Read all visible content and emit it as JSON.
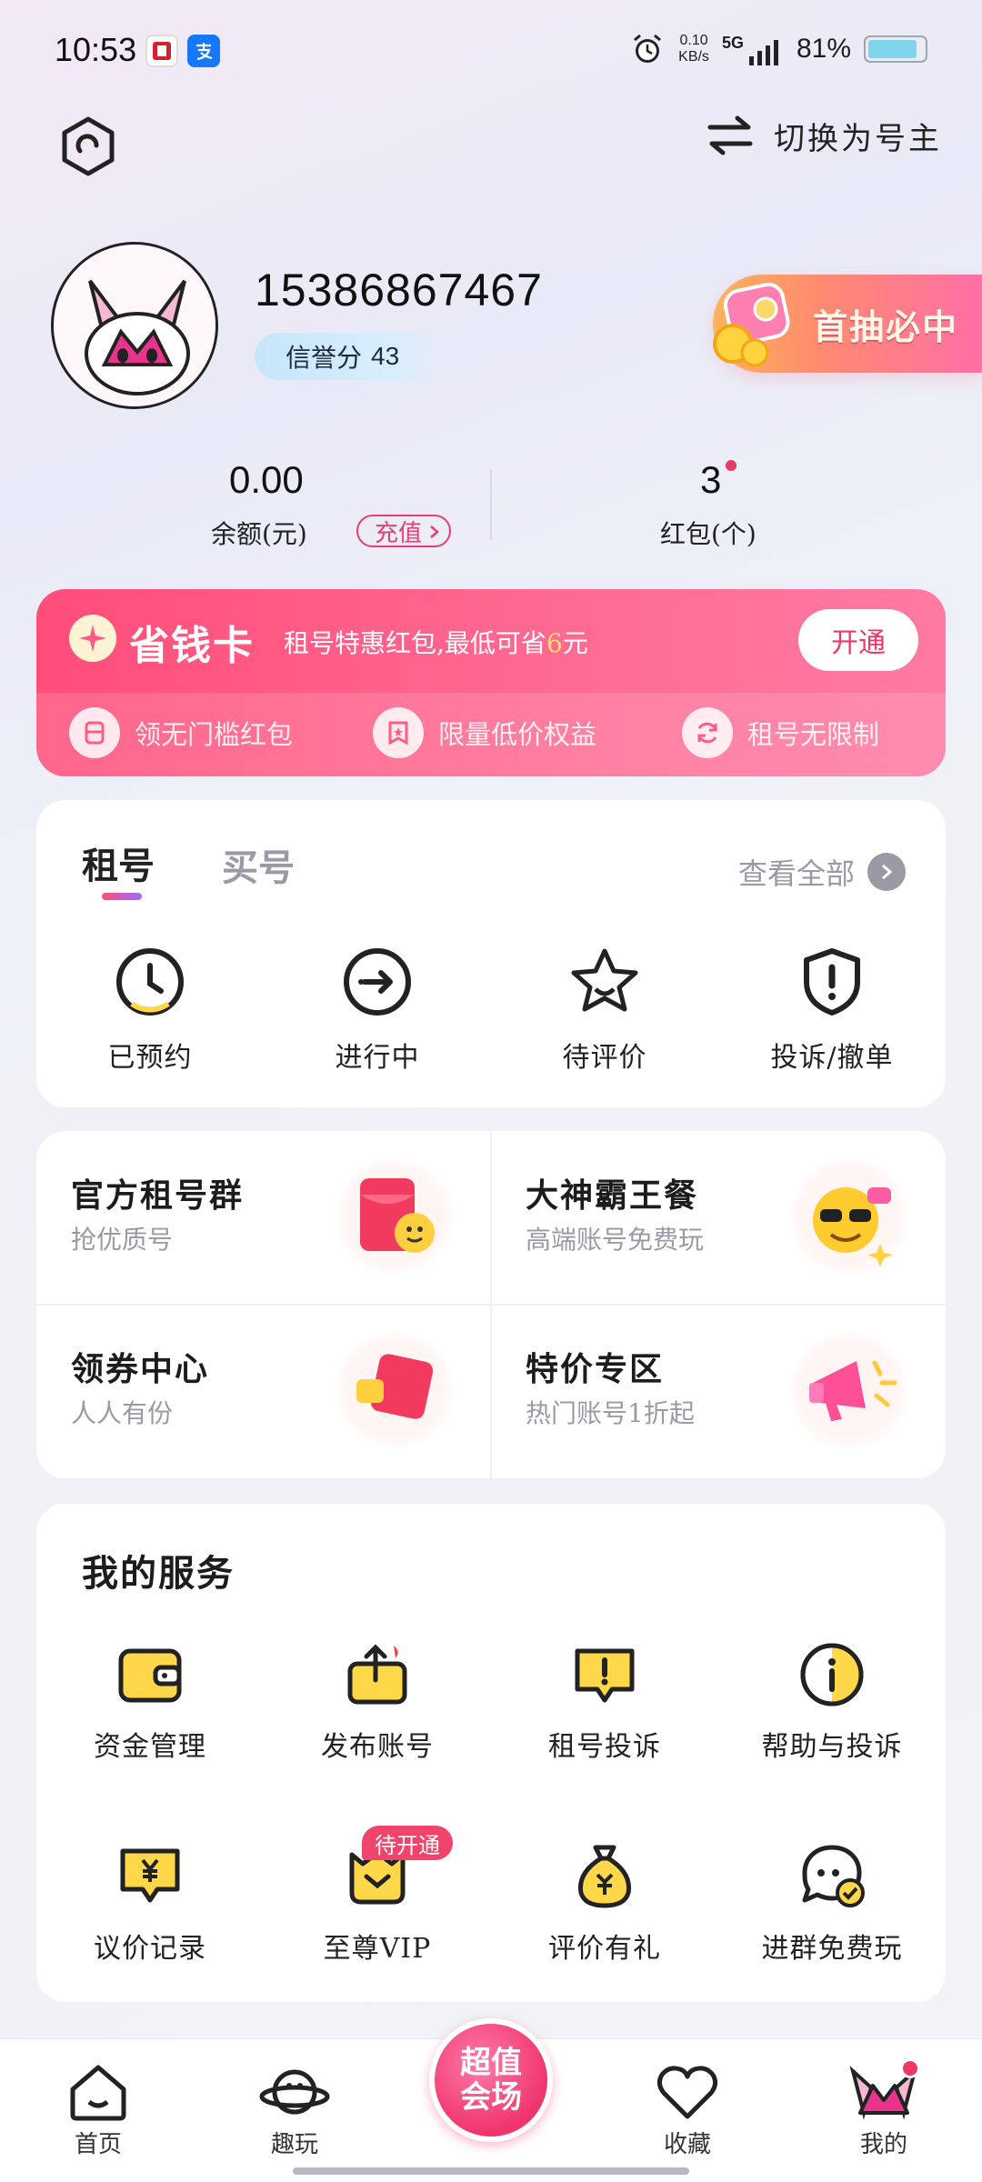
{
  "status_bar": {
    "time": "10:53",
    "net_speed_value": "0.10",
    "net_speed_unit": "KB/s",
    "network": "5G",
    "battery": "81%"
  },
  "header": {
    "switch_label": "切换为号主"
  },
  "profile": {
    "phone": "15386867467",
    "credit_label": "信誉分",
    "credit_value": "43",
    "promo": "首抽必中"
  },
  "wallet": {
    "balance_value": "0.00",
    "balance_label": "余额(元)",
    "recharge_label": "充值",
    "redpacket_value": "3",
    "redpacket_label": "红包(个)"
  },
  "savings_card": {
    "title": "省钱卡",
    "desc_prefix": "租号特惠红包,最低可省",
    "desc_amount": "6",
    "desc_suffix": "元",
    "open_label": "开通",
    "benefits": [
      "领无门槛红包",
      "限量低价权益",
      "租号无限制"
    ]
  },
  "orders": {
    "tab_active": "租号",
    "tab_inactive": "买号",
    "view_all": "查看全部",
    "items": [
      "已预约",
      "进行中",
      "待评价",
      "投诉/撤单"
    ]
  },
  "grid": [
    {
      "title": "官方租号群",
      "subtitle": "抢优质号"
    },
    {
      "title": "大神霸王餐",
      "subtitle": "高端账号免费玩"
    },
    {
      "title": "领券中心",
      "subtitle": "人人有份"
    },
    {
      "title": "特价专区",
      "subtitle": "热门账号1折起"
    }
  ],
  "services": {
    "title": "我的服务",
    "items": [
      "资金管理",
      "发布账号",
      "租号投诉",
      "帮助与投诉",
      "议价记录",
      "至尊VIP",
      "评价有礼",
      "进群免费玩"
    ],
    "vip_badge": "待开通"
  },
  "bottom_nav": {
    "items": [
      "首页",
      "趣玩",
      "收藏",
      "我的"
    ],
    "center_line1": "超值",
    "center_line2": "会场"
  },
  "colors": {
    "accent": "#f0446d",
    "card_pink": "#ff5c85",
    "credit_badge": "#cfe9fb"
  }
}
